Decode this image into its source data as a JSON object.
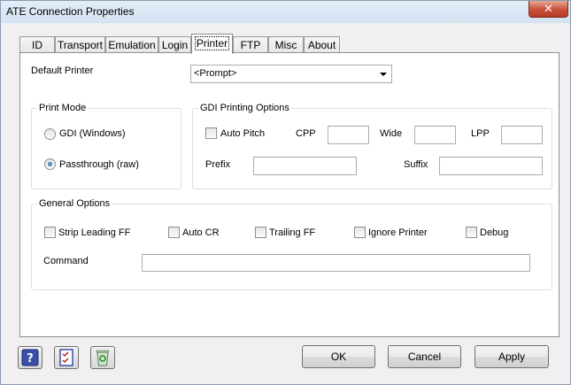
{
  "window": {
    "title": "ATE Connection Properties",
    "close_symbol": "✕"
  },
  "tabs": [
    "ID",
    "Transport",
    "Emulation",
    "Login",
    "Printer",
    "FTP",
    "Misc",
    "About"
  ],
  "active_tab": "Printer",
  "printer": {
    "default_printer_label": "Default Printer",
    "default_printer_value": "<Prompt>"
  },
  "print_mode": {
    "title": "Print Mode",
    "gdi_label": "GDI (Windows)",
    "passthrough_label": "Passthrough (raw)",
    "selected": "Passthrough (raw)"
  },
  "gdi_options": {
    "title": "GDI Printing Options",
    "auto_pitch_label": "Auto Pitch",
    "cpp_label": "CPP",
    "wide_label": "Wide",
    "lpp_label": "LPP",
    "prefix_label": "Prefix",
    "suffix_label": "Suffix",
    "cpp_value": "",
    "wide_value": "",
    "lpp_value": "",
    "prefix_value": "",
    "suffix_value": ""
  },
  "general_options": {
    "title": "General Options",
    "strip_leading_ff": "Strip Leading FF",
    "auto_cr": "Auto CR",
    "trailing_ff": "Trailing FF",
    "ignore_printer": "Ignore Printer",
    "debug": "Debug",
    "command_label": "Command",
    "command_value": ""
  },
  "buttons": {
    "ok": "OK",
    "cancel": "Cancel",
    "apply": "Apply"
  },
  "icons": [
    "help-icon",
    "checklist-icon",
    "recycle-bin-icon"
  ]
}
